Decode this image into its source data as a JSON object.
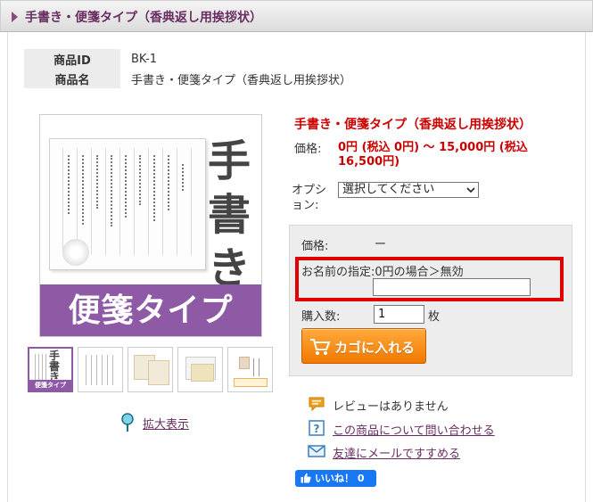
{
  "header": {
    "title": "手書き・便箋タイプ（香典返し用挨拶状）"
  },
  "spec": [
    {
      "key": "商品ID",
      "value": "BK-1"
    },
    {
      "key": "商品名",
      "value": "手書き・便箋タイプ（香典返し用挨拶状）"
    }
  ],
  "image": {
    "big_text": "手書き",
    "band_text": "便箋タイプ",
    "thumb_kanji": "手書き",
    "thumb_band": "便箋タイプ"
  },
  "zoom": {
    "label": "拡大表示"
  },
  "product": {
    "name": "手書き・便箋タイプ（香典返し用挨拶状）",
    "price_label": "価格:",
    "price_value": "0円 (税込 0円) ～ 15,000円 (税込 16,500円)",
    "option_label": "オプション:",
    "option_selected": "選択してください"
  },
  "cart": {
    "price_label": "価格:",
    "price_value": "ー",
    "name_label": "お名前の指定:0円の場合＞無効",
    "name_value": "",
    "qty_label": "購入数:",
    "qty_value": "1",
    "qty_unit": "枚",
    "button_label": "カゴに入れる"
  },
  "links": {
    "review": "レビューはありません",
    "inquiry": "この商品について問い合わせる",
    "mail": "友達にメールですすめる"
  },
  "facebook": {
    "label": "いいね！ 0"
  },
  "colors": {
    "accent": "#6a2d62",
    "price_red": "#cc0000",
    "band_purple": "#8e5aa6",
    "cart_orange": "#f07800",
    "highlight_red": "#e00000",
    "fb_blue": "#1877f2"
  }
}
